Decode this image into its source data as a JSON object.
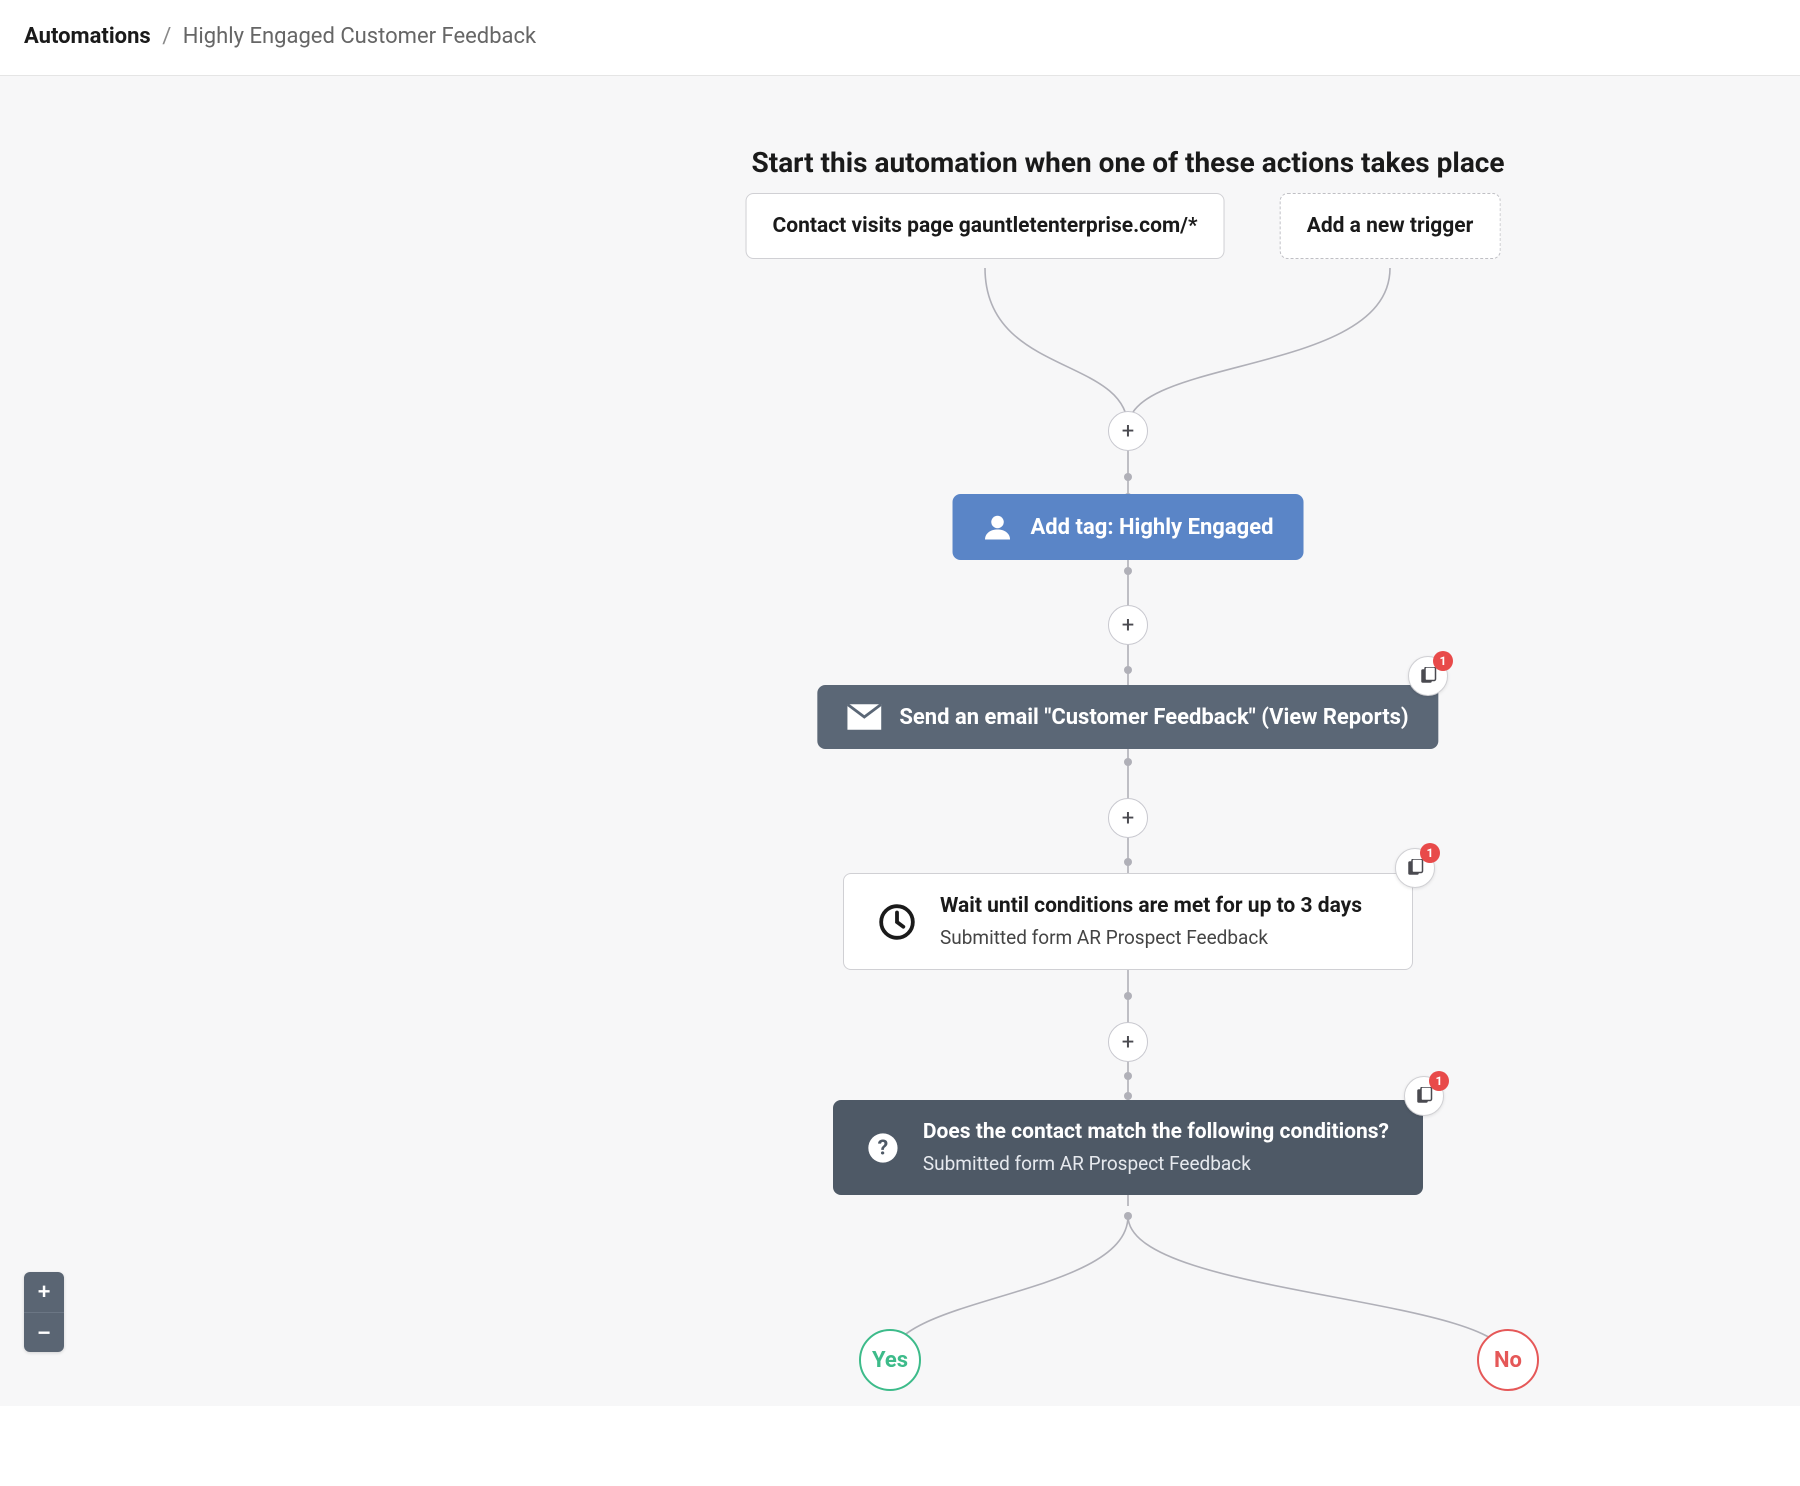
{
  "breadcrumb": {
    "root": "Automations",
    "sep": "/",
    "current": "Highly Engaged Customer Feedback"
  },
  "flow": {
    "title": "Start this automation when one of these actions takes place",
    "trigger1": "Contact visits page gauntletenterprise.com/*",
    "addTrigger": "Add a new trigger",
    "addTagLabel": "Add tag: Highly Engaged",
    "sendEmailLabel": "Send an email \"Customer Feedback\" (View Reports)",
    "wait": {
      "title": "Wait until conditions are met for up to 3 days",
      "sub": "Submitted form AR Prospect Feedback"
    },
    "condition": {
      "title": "Does the contact match the following conditions?",
      "sub": "Submitted form AR Prospect Feedback"
    },
    "yes": "Yes",
    "no": "No"
  },
  "badges": {
    "count1": "1",
    "count2": "1",
    "count3": "1"
  },
  "icons": {
    "plus": "+",
    "minus": "−"
  }
}
